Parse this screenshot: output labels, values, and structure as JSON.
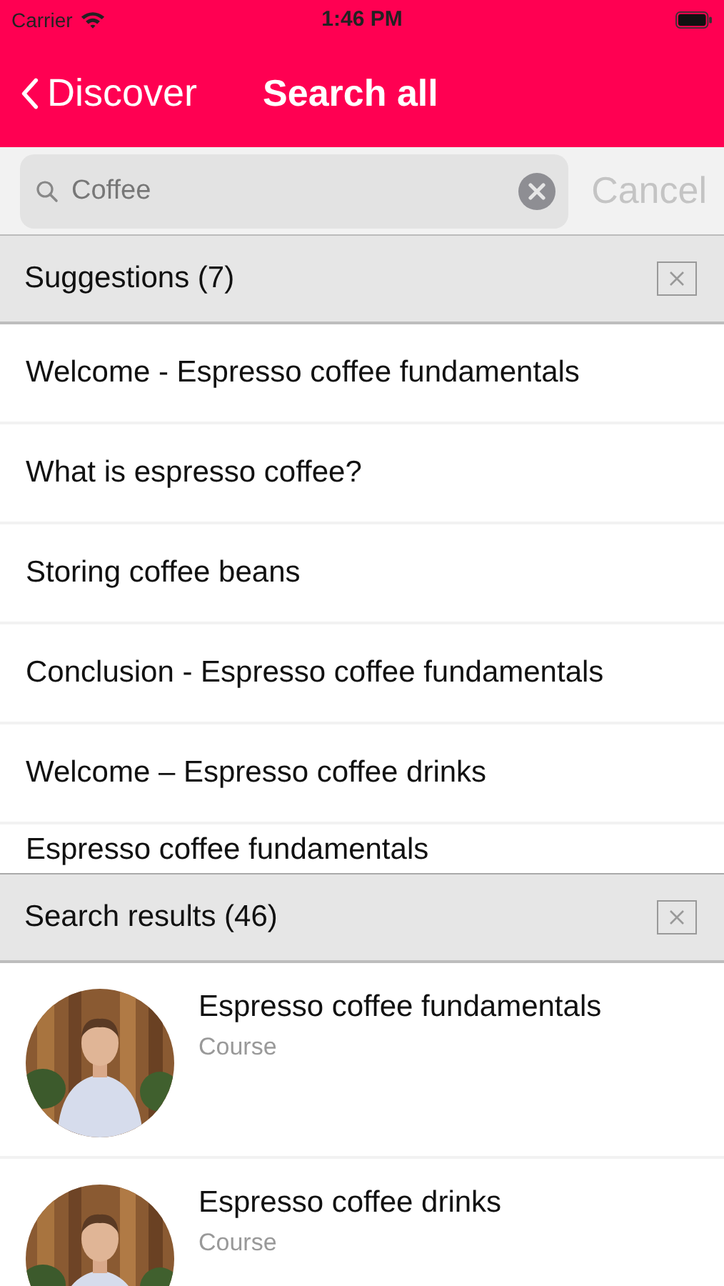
{
  "status_bar": {
    "carrier": "Carrier",
    "time": "1:46 PM"
  },
  "nav": {
    "back": "Discover",
    "title": "Search all"
  },
  "search": {
    "value": "Coffee",
    "cancel": "Cancel"
  },
  "suggestions": {
    "title": "Suggestions (7)",
    "items": [
      {
        "label": "Welcome - Espresso coffee fundamentals"
      },
      {
        "label": "What is espresso coffee?"
      },
      {
        "label": "Storing coffee beans"
      },
      {
        "label": "Conclusion - Espresso coffee fundamentals"
      },
      {
        "label": "Welcome – Espresso coffee drinks"
      },
      {
        "label": "Espresso coffee fundamentals"
      }
    ]
  },
  "results": {
    "title": "Search results (46)",
    "items": [
      {
        "title": "Espresso coffee fundamentals",
        "type": "Course"
      },
      {
        "title": "Espresso coffee drinks",
        "type": "Course"
      }
    ]
  }
}
